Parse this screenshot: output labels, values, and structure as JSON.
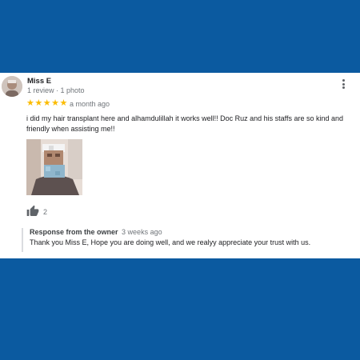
{
  "review": {
    "author": "Miss E",
    "author_meta": "1 review · 1 photo",
    "stars": "★★★★★",
    "rating": 5,
    "time_ago": "a month ago",
    "text": "i did my hair transplant here and alhamdulillah it works well!! Doc Ruz and his staffs are so kind and friendly when assisting me!!",
    "like_count": "2",
    "more_icon": "more-vert-icon",
    "like_icon": "thumbs-up-icon"
  },
  "owner_response": {
    "title": "Response from the owner",
    "time_ago": "3 weeks ago",
    "text": "Thank you Miss E, Hope you are doing well, and we realyy appreciate your trust with us."
  },
  "colors": {
    "page_background": "#0b5aa0",
    "card_background": "#ffffff",
    "star": "#fbbc04",
    "secondary_text": "#70757a"
  }
}
